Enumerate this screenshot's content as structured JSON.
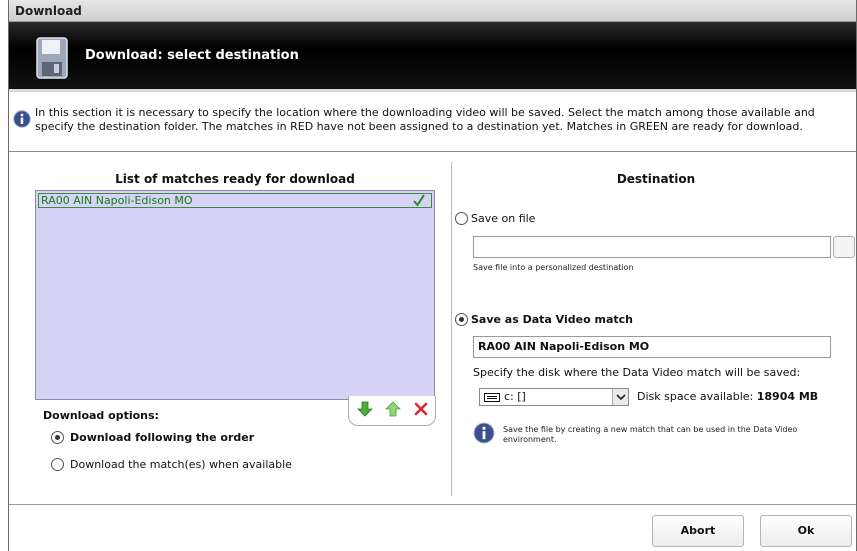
{
  "window": {
    "title": "Download"
  },
  "banner": {
    "title": "Download: select destination",
    "icon": "floppy-disk-icon"
  },
  "info": {
    "text": "In this section it is necessary to specify the location where the downloading video will be saved. Select the match among those available and specify the destination folder. The matches in RED have not been assigned to a destination yet. Matches in GREEN are ready for download."
  },
  "matches": {
    "heading": "List of matches ready for download",
    "items": [
      {
        "label": "RA00 AIN Napoli-Edison MO",
        "status": "ready",
        "color": "#118011"
      }
    ],
    "toolbar": {
      "down": "arrow-down-icon",
      "up": "arrow-up-icon",
      "delete": "delete-icon"
    }
  },
  "download_options": {
    "label": "Download options:",
    "options": [
      {
        "label": "Download following the order",
        "selected": true
      },
      {
        "label": "Download the match(es) when available",
        "selected": false
      }
    ]
  },
  "destination": {
    "heading": "Destination",
    "save_on_file": {
      "label": "Save on file",
      "selected": false,
      "value": "",
      "hint": "Save file into a personalized destination"
    },
    "save_as_match": {
      "label": "Save as Data Video match",
      "selected": true,
      "name_value": "RA00 AIN Napoli-Edison MO",
      "disk_prompt": "Specify the disk where the Data Video match will be saved:",
      "disk_selected": "c: []",
      "space_label": "Disk space available:",
      "space_value": "18904 MB",
      "note": "Save the file by creating a new match that can be used in the Data Video environment."
    }
  },
  "buttons": {
    "abort": "Abort",
    "ok": "Ok"
  }
}
